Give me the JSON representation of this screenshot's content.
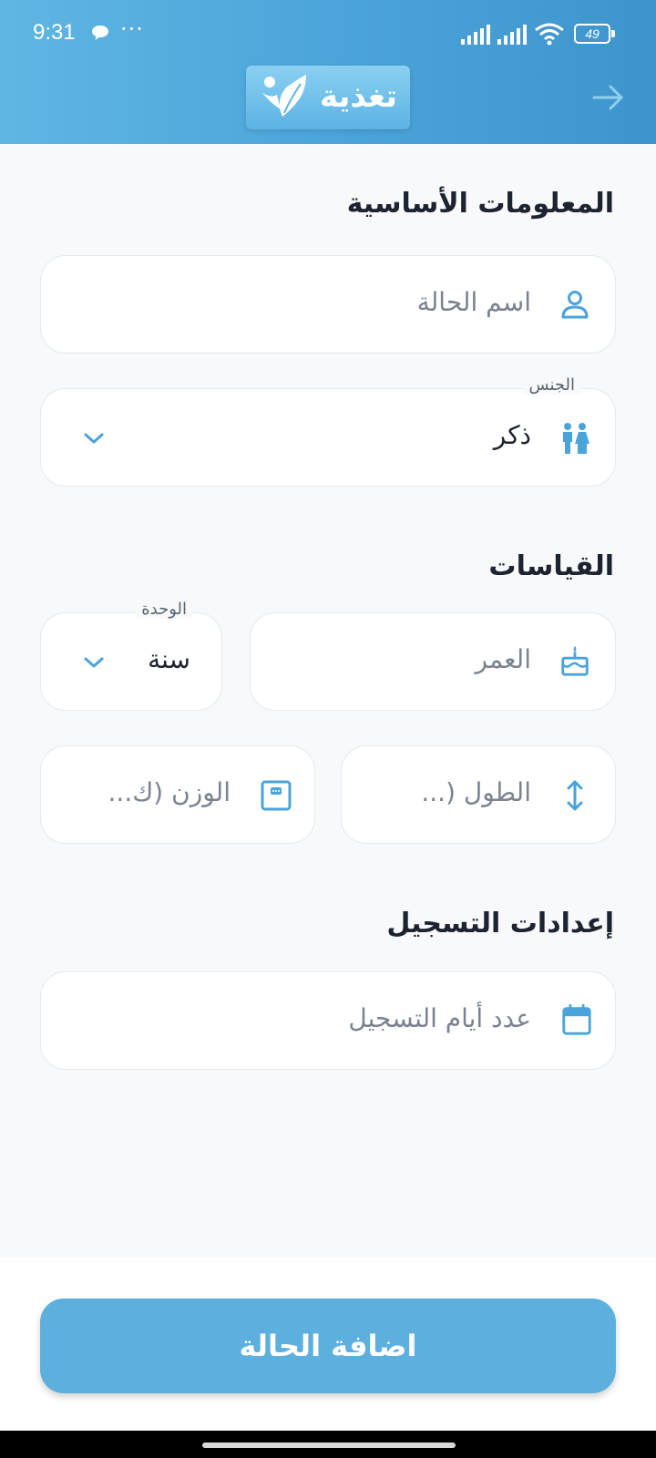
{
  "status_bar": {
    "time": "9:31",
    "battery": "49"
  },
  "header": {
    "app_name": "تغذية"
  },
  "sections": {
    "basic_info": "المعلومات الأساسية",
    "measurements": "القياسات",
    "registration": "إعدادات التسجيل"
  },
  "fields": {
    "case_name": {
      "placeholder": "اسم الحالة"
    },
    "gender": {
      "label": "الجنس",
      "value": "ذكر"
    },
    "age": {
      "placeholder": "العمر"
    },
    "unit": {
      "label": "الوحدة",
      "value": "سنة"
    },
    "height": {
      "placeholder": "الطول (..."
    },
    "weight": {
      "placeholder": "الوزن (ك..."
    },
    "registration_days": {
      "placeholder": "عدد أيام التسجيل"
    }
  },
  "actions": {
    "add_case": "اضافة الحالة"
  },
  "colors": {
    "accent": "#5db0de",
    "header": "#4aa3d9",
    "icon": "#4aa3d9"
  },
  "icons": {
    "case_name": "person-icon",
    "gender": "people-icon",
    "age": "cake-icon",
    "height": "vertical-arrows-icon",
    "weight": "scale-icon",
    "registration_days": "calendar-icon"
  }
}
